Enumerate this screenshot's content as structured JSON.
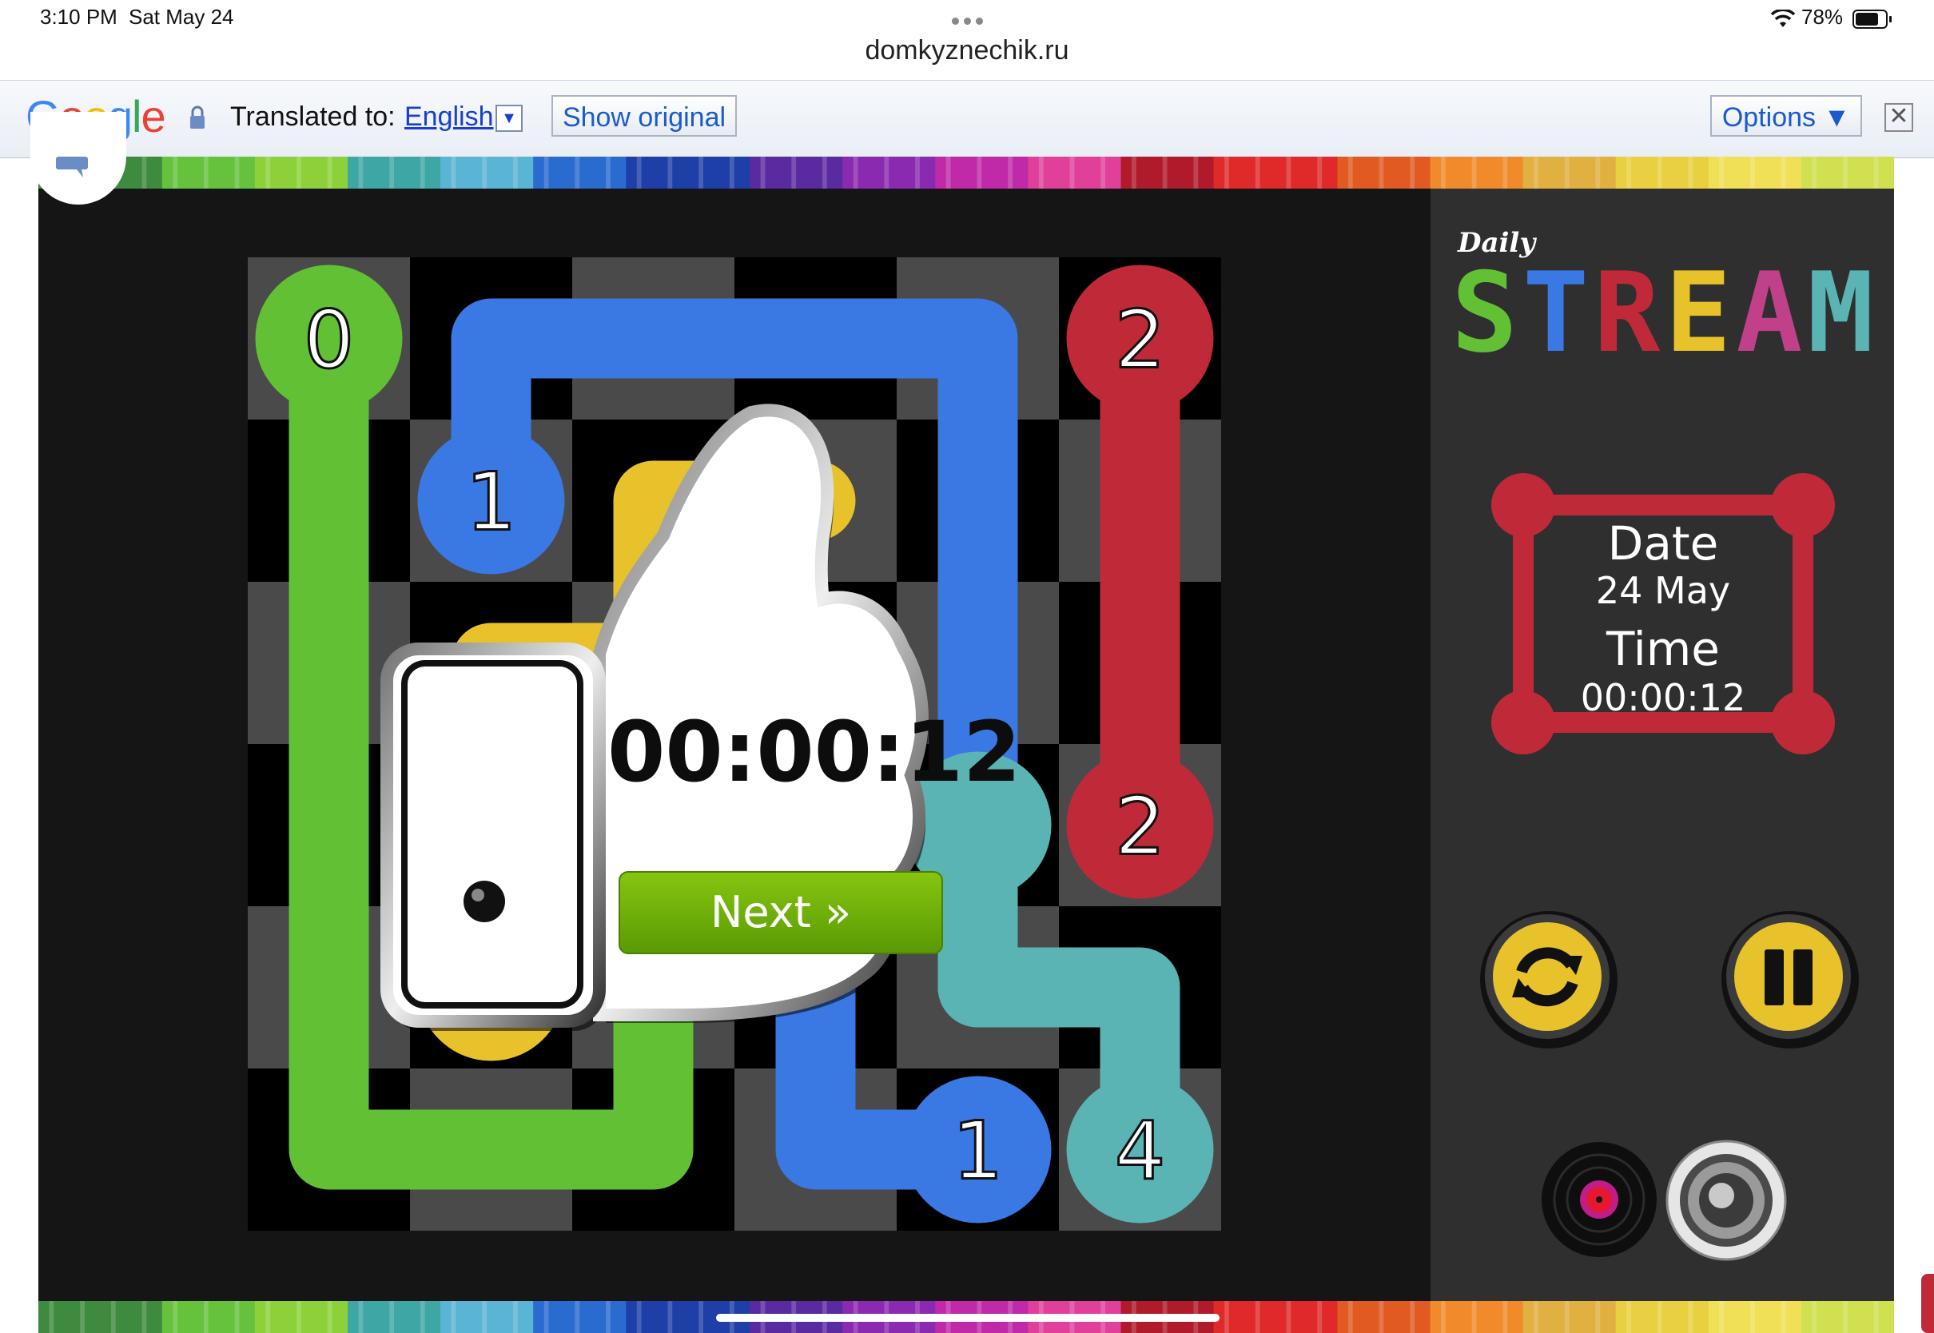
{
  "status_bar": {
    "time": "3:10 PM",
    "date": "Sat May 24",
    "battery": "78%",
    "battery_level": 0.78
  },
  "browser": {
    "url": "domkyznechik.ru"
  },
  "translate_bar": {
    "logo": "Google",
    "translated_to_label": "Translated to:",
    "language": "English",
    "show_original": "Show original",
    "options": "Options ▼",
    "close": "✕"
  },
  "game": {
    "logo_small": "Daily",
    "logo_large": "STREAM",
    "date_label": "Date",
    "date_value": "24 May",
    "time_label": "Time",
    "time_value": "00:00:12",
    "board_numbers": [
      "0",
      "1",
      "2",
      "2",
      "1",
      "4"
    ],
    "colors": {
      "green": "#62c034",
      "blue": "#3a78e4",
      "red": "#c02a38",
      "yellow": "#e7c22a",
      "teal": "#5ab4b4"
    }
  },
  "popup": {
    "timer": "00:00:12",
    "next_label": "Next »"
  },
  "icons": [
    "lock-icon",
    "dropdown-arrow-icon",
    "close-icon",
    "wifi-icon",
    "battery-icon",
    "restart-icon",
    "pause-icon",
    "music-icon",
    "speaker-icon",
    "thumbs-up-icon"
  ]
}
